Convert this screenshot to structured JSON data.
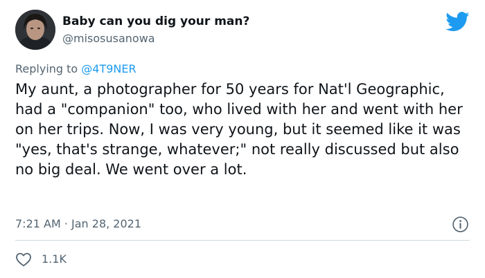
{
  "tweet": {
    "display_name": "Baby can you dig your man?",
    "handle": "@misosusanowa",
    "reply_prefix": "Replying to ",
    "reply_to": "@4T9NER",
    "text": "My aunt, a photographer for 50 years for Nat'l Geographic, had a \"companion\" too, who lived with her and went with her on her trips. Now, I was very young, but it seemed like it was \"yes, that's strange, whatever;\" not really discussed but also no big deal. We went over a lot.",
    "timestamp": "7:21 AM · Jan 28, 2021",
    "like_count": "1.1K"
  },
  "icons": {
    "brand": "twitter-bird-icon",
    "info": "info-icon",
    "like": "heart-icon"
  },
  "colors": {
    "accent": "#1d9bf0",
    "text": "#0f1419",
    "muted": "#536471",
    "divider": "#cfd9de"
  }
}
